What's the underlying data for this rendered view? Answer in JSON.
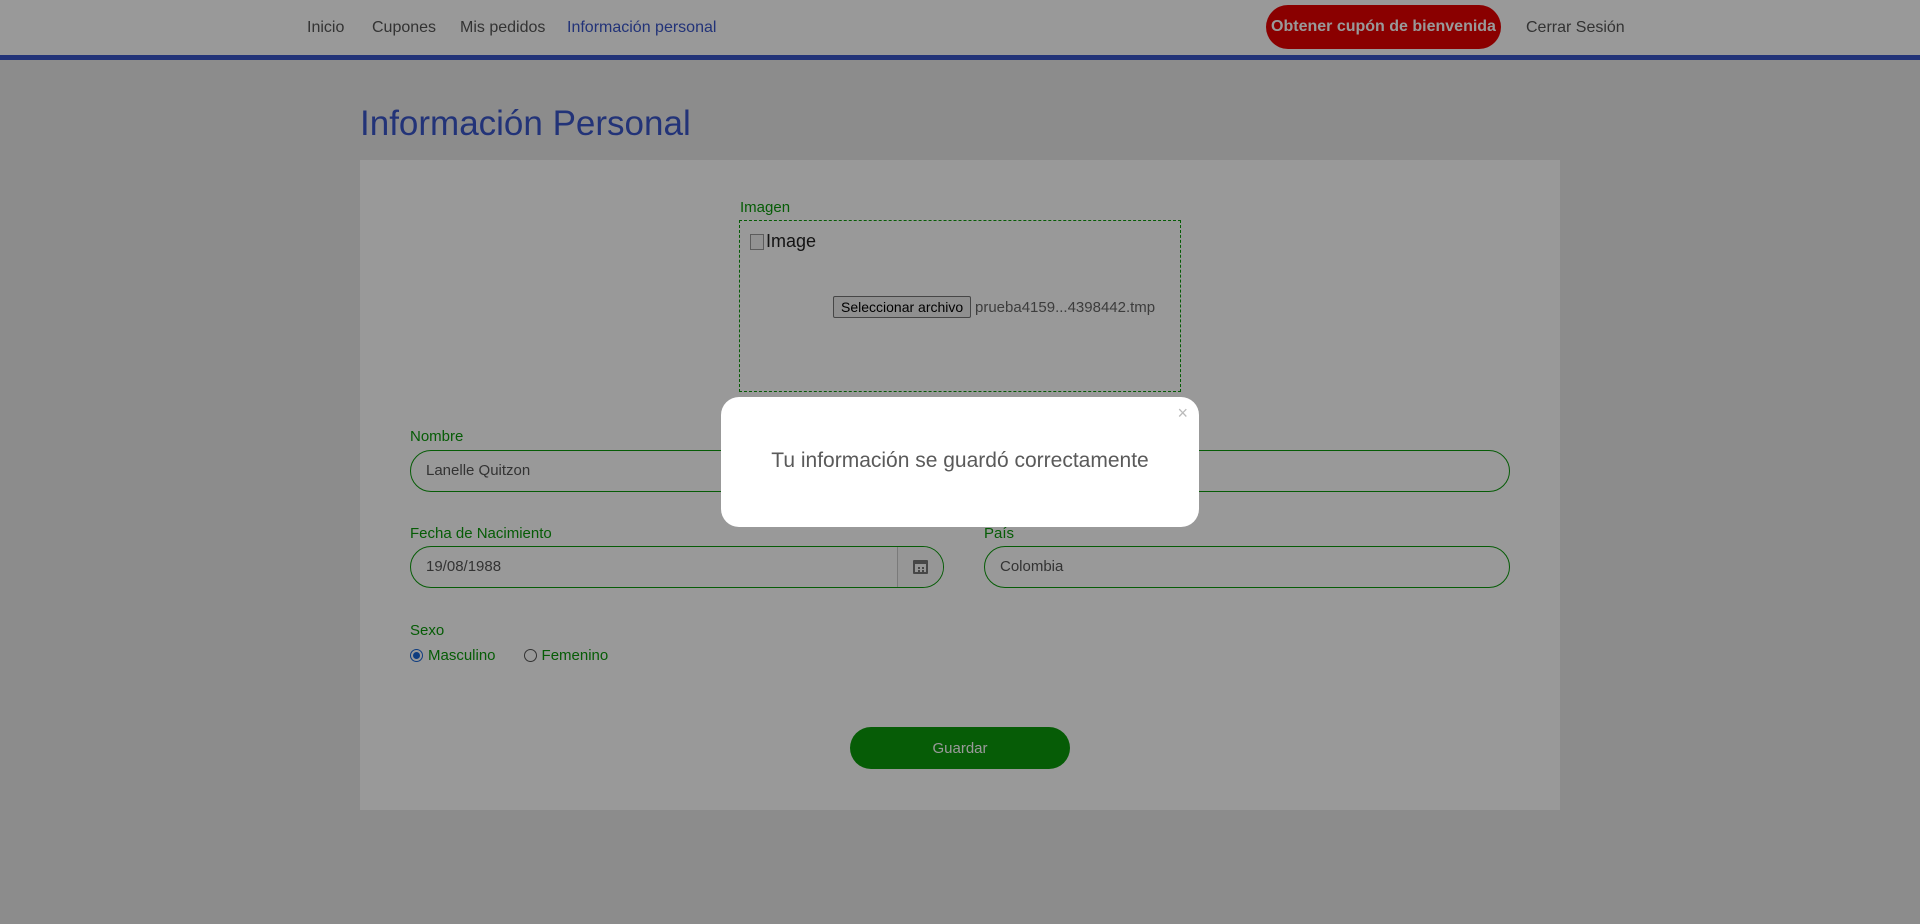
{
  "nav": {
    "links": [
      "Inicio",
      "Cupones",
      "Mis pedidos",
      "Información personal"
    ],
    "active": "Información personal",
    "coupon_button": "Obtener cupón de bienvenida",
    "logout": "Cerrar Sesión"
  },
  "page": {
    "title": "Información Personal"
  },
  "form": {
    "image_label": "Imagen",
    "broken_image_alt": "Image",
    "file_button": "Seleccionar archivo",
    "file_name": "prueba4159...4398442.tmp",
    "name_label": "Nombre",
    "name_value": "Lanelle Quitzon",
    "birth_label": "Fecha de Nacimiento",
    "birth_value": "19/08/1988",
    "country_label": "País",
    "country_value": "Colombia",
    "sex_label": "Sexo",
    "sex_options": [
      "Masculino",
      "Femenino"
    ],
    "sex_selected": "Masculino",
    "save_button": "Guardar"
  },
  "modal": {
    "message": "Tu información se guardó correctamente",
    "close": "×"
  },
  "colors": {
    "primary_blue": "#3a55c9",
    "green": "#0a9a0a",
    "red_button": "#e60000"
  }
}
